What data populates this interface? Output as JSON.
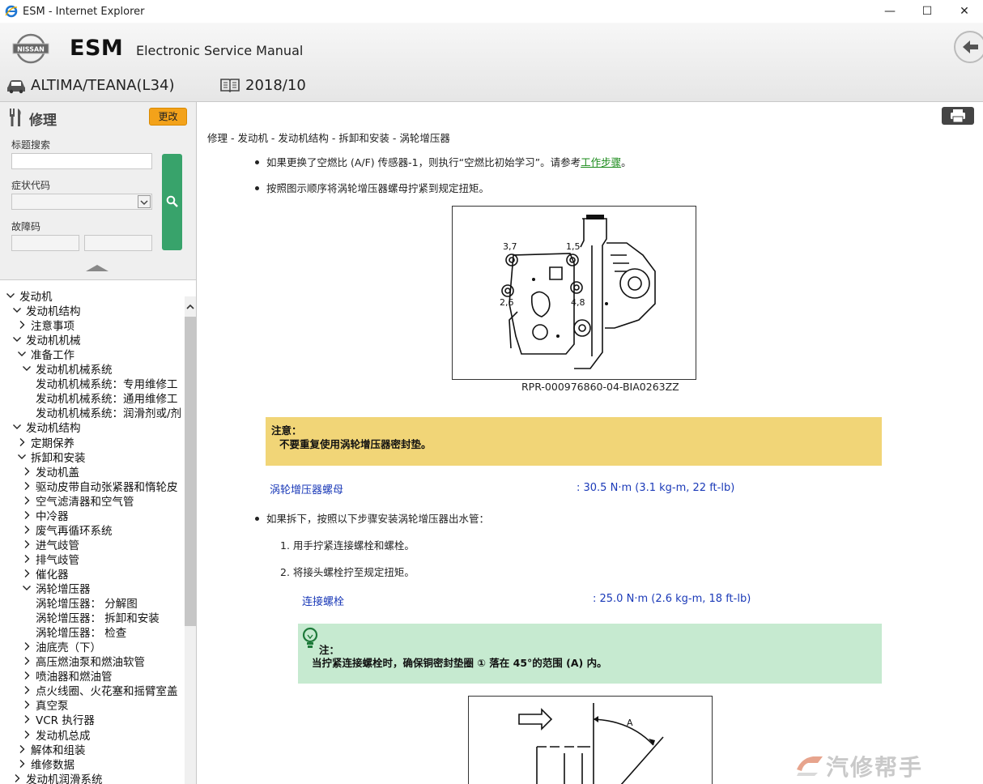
{
  "window": {
    "title": "ESM - Internet Explorer",
    "min": "—",
    "max": "☐",
    "close": "✕"
  },
  "header": {
    "brand": "ESM",
    "subtitle": "Electronic Service Manual",
    "model": "ALTIMA/TEANA(L34)",
    "year": "2018/10"
  },
  "search": {
    "section_title": "修理",
    "change_label": "更改",
    "title_search_label": "标题搜索",
    "symptom_label": "症状代码",
    "dtc_label": "故障码"
  },
  "tree": [
    {
      "label": "发动机",
      "level": 0,
      "state": "open"
    },
    {
      "label": "发动机结构",
      "level": 1,
      "state": "open"
    },
    {
      "label": "注意事项",
      "level": 2,
      "state": "closed"
    },
    {
      "label": "发动机机械",
      "level": 1,
      "state": "open"
    },
    {
      "label": "准备工作",
      "level": 2,
      "state": "open"
    },
    {
      "label": "发动机机械系统",
      "level": 3,
      "state": "open"
    },
    {
      "label": "发动机机械系统：专用维修工",
      "level": 4,
      "state": "leaf"
    },
    {
      "label": "发动机机械系统：通用维修工",
      "level": 4,
      "state": "leaf"
    },
    {
      "label": "发动机机械系统：润滑剂或/剂",
      "level": 4,
      "state": "leaf"
    },
    {
      "label": "发动机结构",
      "level": 1,
      "state": "open"
    },
    {
      "label": "定期保养",
      "level": 2,
      "state": "closed"
    },
    {
      "label": "拆卸和安装",
      "level": 2,
      "state": "open"
    },
    {
      "label": "发动机盖",
      "level": 3,
      "state": "closed"
    },
    {
      "label": "驱动皮带自动张紧器和惰轮皮",
      "level": 3,
      "state": "closed"
    },
    {
      "label": "空气滤清器和空气管",
      "level": 3,
      "state": "closed"
    },
    {
      "label": "中冷器",
      "level": 3,
      "state": "closed"
    },
    {
      "label": "废气再循环系统",
      "level": 3,
      "state": "closed"
    },
    {
      "label": "进气歧管",
      "level": 3,
      "state": "closed"
    },
    {
      "label": "排气歧管",
      "level": 3,
      "state": "closed"
    },
    {
      "label": "催化器",
      "level": 3,
      "state": "closed"
    },
    {
      "label": "涡轮增压器",
      "level": 3,
      "state": "open"
    },
    {
      "label": "涡轮增压器： 分解图",
      "level": 4,
      "state": "leaf"
    },
    {
      "label": "涡轮增压器： 拆卸和安装",
      "level": 4,
      "state": "leaf"
    },
    {
      "label": "涡轮增压器： 检查",
      "level": 4,
      "state": "leaf"
    },
    {
      "label": "油底壳（下）",
      "level": 3,
      "state": "closed"
    },
    {
      "label": "高压燃油泵和燃油软管",
      "level": 3,
      "state": "closed"
    },
    {
      "label": "喷油器和燃油管",
      "level": 3,
      "state": "closed"
    },
    {
      "label": "点火线圈、火花塞和摇臂室盖",
      "level": 3,
      "state": "closed"
    },
    {
      "label": "真空泵",
      "level": 3,
      "state": "closed"
    },
    {
      "label": "VCR 执行器",
      "level": 3,
      "state": "closed"
    },
    {
      "label": "发动机总成",
      "level": 3,
      "state": "closed"
    },
    {
      "label": "解体和组装",
      "level": 2,
      "state": "closed"
    },
    {
      "label": "维修数据",
      "level": 2,
      "state": "closed"
    },
    {
      "label": "发动机润滑系统",
      "level": 1,
      "state": "closed"
    }
  ],
  "content": {
    "breadcrumb": "修理 - 发动机 - 发动机结构 - 拆卸和安装 - 涡轮增压器",
    "bullet1_pre": "如果更换了空燃比 (A/F) 传感器-1，则执行“空燃比初始学习”。请参考",
    "bullet1_link": "工作步骤",
    "bullet1_post": "。",
    "bullet2": "按照图示顺序将涡轮增压器螺母拧紧到规定扭矩。",
    "fig_labels": {
      "a": "3,7",
      "b": "1,5",
      "c": "2,6",
      "d": "4,8"
    },
    "fig_caption": "RPR-000976860-04-BIA0263ZZ",
    "caution_title": "注意：",
    "caution_text": "不要重复使用涡轮增压器密封垫。",
    "spec1_name": "涡轮增压器螺母",
    "spec1_value": ": 30.5 N·m (3.1 kg-m, 22 ft-lb)",
    "bullet3": "如果拆下，按照以下步骤安装涡轮增压器出水管：",
    "step1": "1.  用手拧紧连接螺栓和螺栓。",
    "step2": "2.  将接头螺栓拧至规定扭矩。",
    "spec2_name": "连接螺栓",
    "spec2_value": ": 25.0 N·m (2.6 kg-m, 18 ft-lb)",
    "note_title": "注：",
    "note_text": "当拧紧连接螺栓时，确保铜密封垫圈 ① 落在 45°的范围 (A) 内。",
    "fig2_label": "A"
  },
  "watermark": "汽修帮手"
}
